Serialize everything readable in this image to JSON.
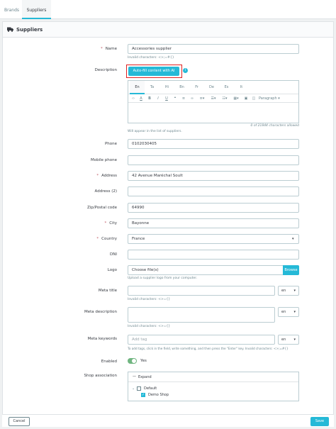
{
  "tabs": [
    {
      "label": "Brands"
    },
    {
      "label": "Suppliers"
    }
  ],
  "card": {
    "title": "Suppliers"
  },
  "form": {
    "name": {
      "label": "Name",
      "value": "Accessories supplier",
      "hint": "Invalid characters: <>;=#{}"
    },
    "description": {
      "label": "Description",
      "ai_button": "Auto-fill content with AI",
      "info_icon": "i",
      "langs": [
        "En",
        "Ta",
        "Hi",
        "Bn",
        "Fr",
        "De",
        "Es",
        "It"
      ],
      "paragraph": "Paragraph",
      "counter": "0 of 21844 characters allowed",
      "hint": "Will appear in the list of suppliers."
    },
    "phone": {
      "label": "Phone",
      "value": "0102030405"
    },
    "mobile_phone": {
      "label": "Mobile phone",
      "value": ""
    },
    "address": {
      "label": "Address",
      "value": "42 Avenue Maréchal Soult"
    },
    "address2": {
      "label": "Address (2)",
      "value": ""
    },
    "zip": {
      "label": "Zip/Postal code",
      "value": "64990"
    },
    "city": {
      "label": "City",
      "value": "Bayonne"
    },
    "country": {
      "label": "Country",
      "value": "France"
    },
    "dni": {
      "label": "DNI",
      "value": ""
    },
    "logo": {
      "label": "Logo",
      "placeholder": "Choose file(s)",
      "browse": "Browse",
      "hint": "Upload a supplier logo from your computer."
    },
    "meta_title": {
      "label": "Meta title",
      "lang": "en",
      "hint": "Invalid characters: <>={}"
    },
    "meta_description": {
      "label": "Meta description",
      "lang": "en",
      "hint": "Invalid characters: <>={}"
    },
    "meta_keywords": {
      "label": "Meta keywords",
      "placeholder": "Add tag",
      "lang": "en",
      "hint": "To add tags, click in the field, write something, and then press the \"Enter\" key. Invalid characters: <>;=#{}"
    },
    "enabled": {
      "label": "Enabled",
      "value": "Yes"
    },
    "shop_association": {
      "label": "Shop association",
      "expand": "Expand",
      "group": "Default",
      "shop": "Demo Shop"
    }
  },
  "footer": {
    "cancel": "Cancel",
    "save": "Save"
  },
  "colors": {
    "accent": "#25b9d7",
    "required": "#c05c67",
    "success": "#70b580",
    "highlight": "#e02020"
  }
}
